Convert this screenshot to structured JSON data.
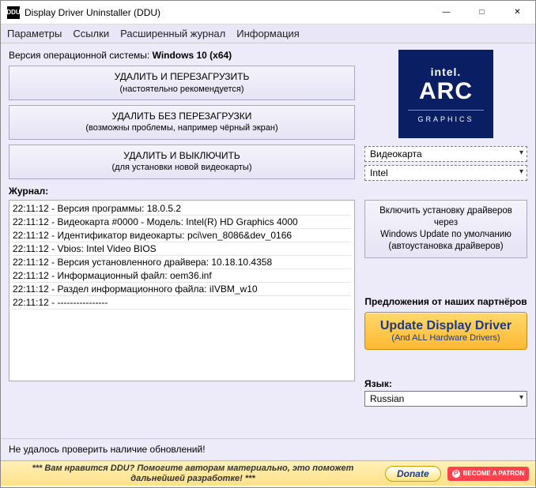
{
  "title": "Display Driver Uninstaller (DDU)",
  "menu": {
    "params": "Параметры",
    "links": "Ссылки",
    "extlog": "Расширенный журнал",
    "info": "Информация"
  },
  "os": {
    "label": "Версия операционной системы:",
    "value": "Windows 10 (x64)"
  },
  "btn1": {
    "t": "УДАЛИТЬ И ПЕРЕЗАГРУЗИТЬ",
    "s": "(настоятельно рекомендуется)"
  },
  "btn2": {
    "t": "УДАЛИТЬ БЕЗ ПЕРЕЗАГРУЗКИ",
    "s": "(возможны проблемы, например чёрный экран)"
  },
  "btn3": {
    "t": "УДАЛИТЬ И ВЫКЛЮЧИТЬ",
    "s": "(для установки новой видеокарты)"
  },
  "log_label": "Журнал:",
  "log": [
    "22:11:12 - Версия программы: 18.0.5.2",
    "22:11:12 - Видеокарта #0000 - Модель: Intel(R) HD Graphics 4000",
    "22:11:12 - Идентификатор видеокарты: pci\\ven_8086&dev_0166",
    "22:11:12 - Vbios: Intel Video BIOS",
    "22:11:12 - Версия установленного драйвера: 10.18.10.4358",
    "22:11:12 - Информационный файл: oem36.inf",
    "22:11:12 - Раздел информационного файла: iIVBM_w10",
    "22:11:12 - ----------------"
  ],
  "brand": {
    "intel": "intel.",
    "arc": "ARC",
    "gfx": "GRAPHICS"
  },
  "device_type": "Видеокарта",
  "vendor": "Intel",
  "winupdate": {
    "l1": "Включить установку драйверов через",
    "l2": "Windows Update по умолчанию",
    "l3": "(автоустановка драйверов)"
  },
  "partner_label": "Предложения от наших партнёров",
  "update_driver": {
    "l1": "Update Display Driver",
    "l2": "(And ALL Hardware Drivers)"
  },
  "lang_label": "Язык:",
  "lang_value": "Russian",
  "status": "Не удалось проверить наличие обновлений!",
  "footer_text": "*** Вам нравится DDU? Помогите авторам материально, это поможет дальнейшей разработке! ***",
  "donate": "Donate",
  "patron": "BECOME A PATRON"
}
